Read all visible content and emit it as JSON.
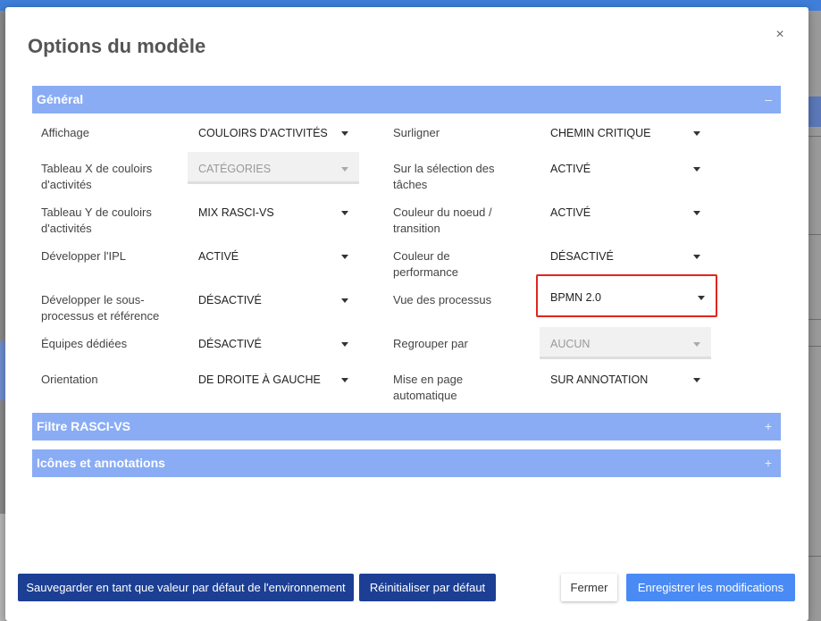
{
  "dialog": {
    "title": "Options du modèle",
    "close_label": "×"
  },
  "sections": {
    "general": {
      "label": "Général",
      "toggle": "–"
    },
    "filtre": {
      "label": "Filtre RASCI-VS",
      "toggle": "+"
    },
    "icones": {
      "label": "Icônes et annotations",
      "toggle": "+"
    }
  },
  "left_options": [
    {
      "label": "Affichage",
      "value": "COULOIRS D'ACTIVITÉS",
      "disabled": false
    },
    {
      "label": "Tableau X de couloirs d'activités",
      "value": "CATÉGORIES",
      "disabled": true
    },
    {
      "label": "Tableau Y de couloirs d'activités",
      "value": "MIX RASCI-VS",
      "disabled": false
    },
    {
      "label": "Développer l'IPL",
      "value": "ACTIVÉ",
      "disabled": false
    },
    {
      "label": "Développer le sous-processus et référence",
      "value": "DÉSACTIVÉ",
      "disabled": false
    },
    {
      "label": "Équipes dédiées",
      "value": "DÉSACTIVÉ",
      "disabled": false
    },
    {
      "label": "Orientation",
      "value": "DE DROITE À GAUCHE",
      "disabled": false
    }
  ],
  "right_options": [
    {
      "label": "Surligner",
      "value": "CHEMIN CRITIQUE",
      "disabled": false
    },
    {
      "label": "Sur la sélection des tâches",
      "value": "ACTIVÉ",
      "disabled": false
    },
    {
      "label": "Couleur du noeud / transition",
      "value": "ACTIVÉ",
      "disabled": false
    },
    {
      "label": "Couleur de performance",
      "value": "DÉSACTIVÉ",
      "disabled": false
    },
    {
      "label": "Vue des processus",
      "value": "BPMN 2.0",
      "disabled": false,
      "highlighted": true
    },
    {
      "label": "Regrouper par",
      "value": "AUCUN",
      "disabled": true
    },
    {
      "label": "Mise en page automatique",
      "value": "SUR ANNOTATION",
      "disabled": false
    }
  ],
  "footer": {
    "save_default_label": "Sauvegarder en tant que valeur par défaut de l'environnement",
    "reset_label": "Réinitialiser par défaut",
    "close_label": "Fermer",
    "save_label": "Enregistrer les modifications"
  },
  "colors": {
    "section_header": "#89acf5",
    "dark_button": "#1c3f94",
    "primary_button": "#4a8af4",
    "highlight_border": "#e0261e"
  }
}
